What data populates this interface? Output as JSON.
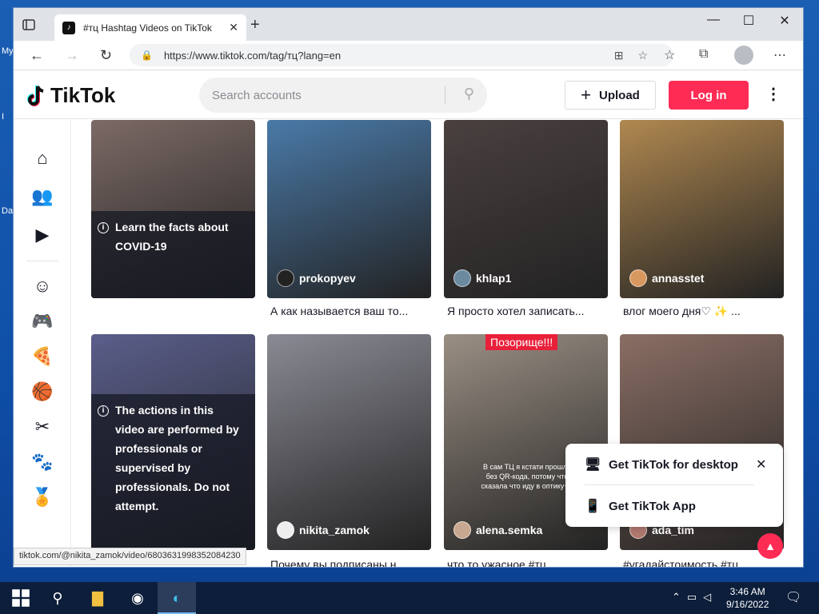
{
  "browser": {
    "tab_title": "#тц Hashtag Videos on TikTok",
    "url": "https://www.tiktok.com/tag/тц?lang=en",
    "status_url": "tiktok.com/@nikita_zamok/video/6803631998352084230"
  },
  "header": {
    "logo": "TikTok",
    "search_placeholder": "Search accounts",
    "upload_label": "Upload",
    "login_label": "Log in"
  },
  "sidebar": {
    "items": [
      {
        "name": "home",
        "glyph": "⌂"
      },
      {
        "name": "following",
        "glyph": "👥"
      },
      {
        "name": "live",
        "glyph": "▶"
      },
      {
        "name": "comedy",
        "glyph": "☺"
      },
      {
        "name": "gaming",
        "glyph": "🎮"
      },
      {
        "name": "food",
        "glyph": "🍕"
      },
      {
        "name": "sports",
        "glyph": "🏀"
      },
      {
        "name": "beauty",
        "glyph": "✂"
      },
      {
        "name": "animals",
        "glyph": "🐾"
      },
      {
        "name": "achievement",
        "glyph": "🏅"
      }
    ]
  },
  "videos": [
    {
      "handle": "",
      "caption": "",
      "notice": "Learn the facts about COVID-19",
      "bg": "#7c6a66",
      "av": "#999"
    },
    {
      "handle": "prokopyev",
      "caption": "А как называется ваш то...",
      "bg": "#4a7aa8",
      "av": "#222"
    },
    {
      "handle": "khlap1",
      "caption": "Я просто хотел записать...",
      "bg": "#4a4040",
      "av": "#6b8aa0"
    },
    {
      "handle": "annasstet",
      "caption": "влог моего дня♡ ✨ ...",
      "bg": "#b08850",
      "av": "#d89860"
    },
    {
      "handle": "",
      "caption": "",
      "notice": "The actions in this video are performed by professionals or supervised by professionals. Do not attempt.",
      "bg": "#5a5e8a",
      "av": "#999"
    },
    {
      "handle": "nikita_zamok",
      "caption": "Почему вы подписаны н...",
      "bg": "#8a8a94",
      "av": "#eee"
    },
    {
      "handle": "alena.semka",
      "caption": "что то ужасное #тц...",
      "badge": "Позорище!!!",
      "overlay": "В сам ТЦ я кстати прошла без QR-кода, потому что сказала что иду в оптику👓",
      "bg": "#9a8f84",
      "av": "#c8a890"
    },
    {
      "handle": "ada_tim",
      "caption": "#угадайстоимость #тц...",
      "bg": "#8a6e64",
      "av": "#b07a70"
    }
  ],
  "popup": {
    "desktop_label": "Get TikTok for desktop",
    "app_label": "Get TikTok App"
  },
  "taskbar": {
    "time": "3:46 AM",
    "date": "9/16/2022"
  },
  "desktop": {
    "labels": [
      "My",
      "I",
      "Da"
    ]
  }
}
